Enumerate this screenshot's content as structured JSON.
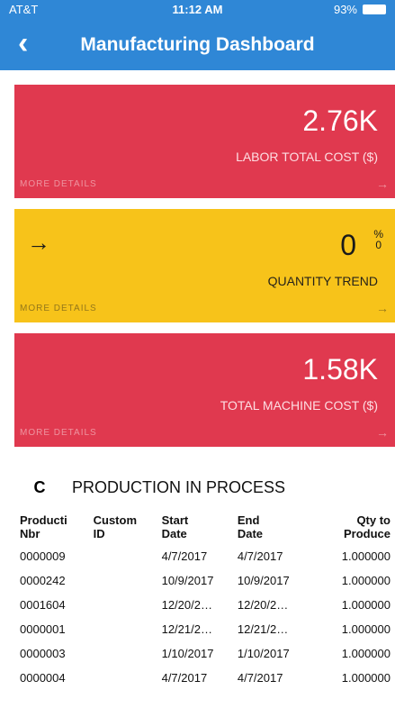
{
  "status_bar": {
    "carrier": "AT&T",
    "time": "11:12 AM",
    "battery": "93%"
  },
  "nav": {
    "title": "Manufacturing Dashboard"
  },
  "cards": [
    {
      "value": "2.76K",
      "label": "LABOR TOTAL COST ($)",
      "more": "MORE DETAILS"
    },
    {
      "value": "0",
      "percent_symbol": "%",
      "percent_value": "0",
      "label": "QUANTITY TREND",
      "more": "MORE DETAILS"
    },
    {
      "value": "1.58K",
      "label": "TOTAL MACHINE COST ($)",
      "more": "MORE DETAILS"
    }
  ],
  "section": {
    "title": "PRODUCTION IN PROCESS"
  },
  "table": {
    "headers": [
      {
        "l1": "Producti",
        "l2": "Nbr"
      },
      {
        "l1": "Custom",
        "l2": "ID"
      },
      {
        "l1": "Start",
        "l2": "Date"
      },
      {
        "l1": "End",
        "l2": "Date"
      },
      {
        "l1": "Qty to",
        "l2": "Produce"
      }
    ],
    "rows": [
      [
        "0000009",
        "",
        "4/7/2017",
        "4/7/2017",
        "1.000000"
      ],
      [
        "0000242",
        "",
        "10/9/2017",
        "10/9/2017",
        "1.000000"
      ],
      [
        "0001604",
        "",
        "12/20/2…",
        "12/20/2…",
        "1.000000"
      ],
      [
        "0000001",
        "",
        "12/21/2…",
        "12/21/2…",
        "1.000000"
      ],
      [
        "0000003",
        "",
        "1/10/2017",
        "1/10/2017",
        "1.000000"
      ],
      [
        "0000004",
        "",
        "4/7/2017",
        "4/7/2017",
        "1.000000"
      ]
    ]
  },
  "colors": {
    "nav": "#2f87d6",
    "red_card": "#e0394f",
    "yellow_card": "#f7c31a"
  }
}
